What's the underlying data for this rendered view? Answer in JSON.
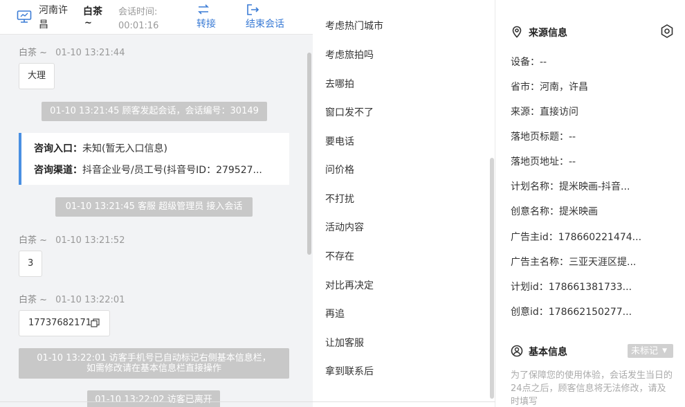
{
  "header": {
    "location": "河南许昌",
    "customer_name": "白茶",
    "customer_tilde": "~",
    "session_time_label": "会话时间:",
    "session_time_value": "00:01:16",
    "transfer_label": "转接",
    "end_label": "结束会话",
    "icons": [
      "monitor-icon",
      "transfer-icon",
      "exit-icon"
    ]
  },
  "chat": {
    "messages": [
      {
        "sender": "白茶 ~",
        "time": "01-10 13:21:44",
        "text": "大理"
      },
      {
        "sender": "白茶 ~",
        "time": "01-10 13:21:52",
        "text": "3"
      },
      {
        "sender": "白茶 ~",
        "time": "01-10 13:22:01",
        "text": "17737682171"
      }
    ],
    "system": {
      "session_start": "01-10 13:21:45 顾客发起会话，会话编号：30149",
      "agent_join": "01-10 13:21:45 客服 超级管理员 接入会话",
      "phone_marked_line1": "01-10 13:22:01 访客手机号已自动标记右侧基本信息栏，",
      "phone_marked_line2": "如需修改请在基本信息栏直接操作",
      "visitor_left": "01-10 13:22:02 访客已离开"
    },
    "consult": {
      "entry_key": "咨询入口：",
      "entry_val": "未知(暂无入口信息)",
      "channel_key": "咨询渠道：",
      "channel_val": "抖音企业号/员工号(抖音号ID：279527..."
    }
  },
  "phrases": {
    "items": [
      "考虑热门城市",
      "考虑旅拍吗",
      "去哪拍",
      "窗口发不了",
      "要电话",
      "问价格",
      "不打扰",
      "活动内容",
      "不存在",
      "对比再决定",
      "再追",
      "让加客服",
      "拿到联系后"
    ]
  },
  "info": {
    "source_title": "来源信息",
    "rows": [
      "设备：--",
      "省市：河南，许昌",
      "来源：直接访问",
      "落地页标题：--",
      "落地页地址：--",
      "计划名称：提米映画-抖音...",
      "创意名称：提米映画",
      "广告主id：178660221474...",
      "广告主名称：三亚天涯区提...",
      "计划id：178661381733...",
      "创意id：178662150277..."
    ],
    "basic_title": "基本信息",
    "tag_button": "未标记",
    "notice": "为了保障您的使用体验，会话发生当日的24点之后，顾客信息将无法修改，请及时填写",
    "accent_color": "#3a7bd5",
    "consult_border_color": "#4a90e2"
  }
}
